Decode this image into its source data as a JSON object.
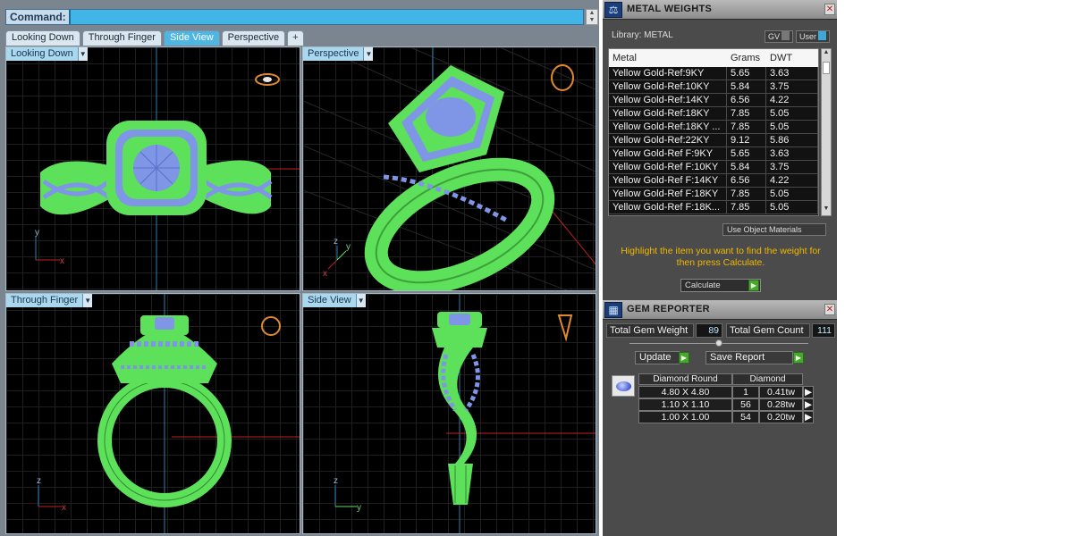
{
  "command": {
    "label": "Command:",
    "value": ""
  },
  "view_tabs": [
    {
      "label": "Looking Down",
      "active": false
    },
    {
      "label": "Through Finger",
      "active": false
    },
    {
      "label": "Side View",
      "active": true
    },
    {
      "label": "Perspective",
      "active": false
    },
    {
      "label": "+",
      "active": false
    }
  ],
  "viewports": [
    {
      "label": "Looking Down",
      "axis_a": "y",
      "axis_b": "x"
    },
    {
      "label": "Perspective",
      "axis_a": "z",
      "axis_b": "y",
      "axis_c": "x"
    },
    {
      "label": "Through Finger",
      "axis_a": "z",
      "axis_b": "x"
    },
    {
      "label": "Side View",
      "axis_a": "z",
      "axis_b": "y"
    }
  ],
  "metal_weights": {
    "title": "METAL WEIGHTS",
    "library_label": "Library: METAL",
    "gv_label": "GV",
    "user_label": "User",
    "columns": [
      "Metal",
      "Grams",
      "DWT"
    ],
    "rows": [
      [
        "Yellow Gold-Ref:9KY",
        "5.65",
        "3.63"
      ],
      [
        "Yellow Gold-Ref:10KY",
        "5.84",
        "3.75"
      ],
      [
        "Yellow Gold-Ref:14KY",
        "6.56",
        "4.22"
      ],
      [
        "Yellow Gold-Ref:18KY",
        "7.85",
        "5.05"
      ],
      [
        "Yellow Gold-Ref:18KY ...",
        "7.85",
        "5.05"
      ],
      [
        "Yellow Gold-Ref:22KY",
        "9.12",
        "5.86"
      ],
      [
        "Yellow Gold-Ref F:9KY",
        "5.65",
        "3.63"
      ],
      [
        "Yellow Gold-Ref F:10KY",
        "5.84",
        "3.75"
      ],
      [
        "Yellow Gold-Ref F:14KY",
        "6.56",
        "4.22"
      ],
      [
        "Yellow Gold-Ref F:18KY",
        "7.85",
        "5.05"
      ],
      [
        "Yellow Gold-Ref F:18K...",
        "7.85",
        "5.05"
      ]
    ],
    "use_object_materials": "Use Object Materials",
    "hint": "Highlight the item you want to find the weight for then press Calculate.",
    "calculate_label": "Calculate"
  },
  "gem_reporter": {
    "title": "GEM REPORTER",
    "total_weight_label": "Total Gem Weight",
    "total_weight_value": "89",
    "total_count_label": "Total Gem Count",
    "total_count_value": "111",
    "update_label": "Update",
    "save_report_label": "Save Report",
    "header_shape": "Diamond Round",
    "header_material": "Diamond",
    "rows": [
      {
        "size": "4.80 X 4.80",
        "count": "1",
        "weight": "0.41tw"
      },
      {
        "size": "1.10 X 1.10",
        "count": "56",
        "weight": "0.28tw"
      },
      {
        "size": "1.00 X 1.00",
        "count": "54",
        "weight": "0.20tw"
      }
    ]
  },
  "colors": {
    "wireframe": "#5de05a",
    "gems": "#7f96e6",
    "grid": "#1f1f1f",
    "accent_blue": "#41b5e8",
    "hint_text": "#f0b800",
    "panel_bg": "#4b4b4b"
  }
}
